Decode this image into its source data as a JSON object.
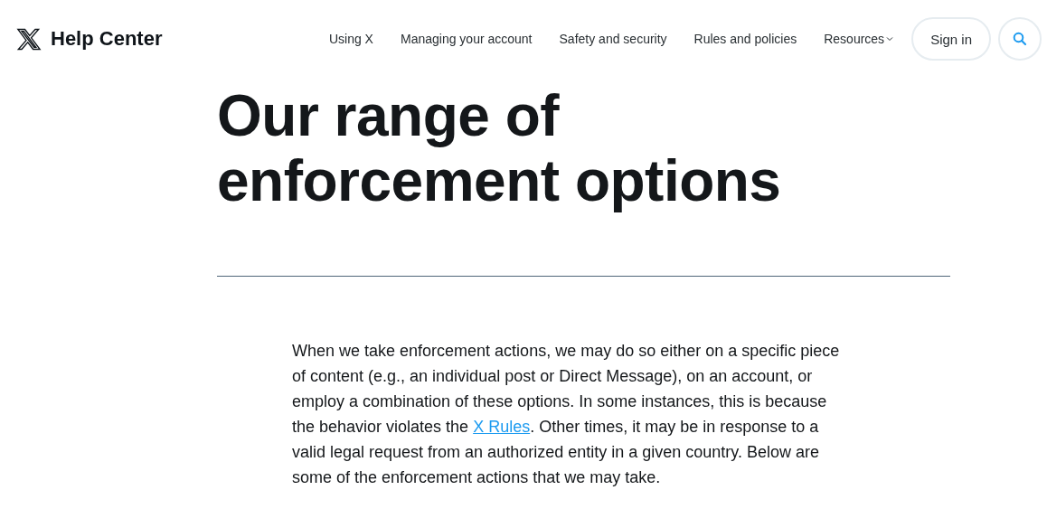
{
  "header": {
    "brand": "Help Center",
    "nav": [
      {
        "label": "Using X",
        "dropdown": false
      },
      {
        "label": "Managing your account",
        "dropdown": false
      },
      {
        "label": "Safety and security",
        "dropdown": false
      },
      {
        "label": "Rules and policies",
        "dropdown": false
      },
      {
        "label": "Resources",
        "dropdown": true
      }
    ],
    "sign_in": "Sign in"
  },
  "article": {
    "title": "Our range of enforcement options",
    "intro": {
      "before": "When we take enforcement actions, we may do so either on a specific piece of content (e.g., an individual post or Direct Message), on an account, or employ a combination of these options. In some instances, this is because the behavior violates the ",
      "link": "X Rules",
      "after": ". Other times, it may be in response to a valid legal request from an authorized entity in a given country. Below are some of the enforcement actions that we may take."
    }
  }
}
